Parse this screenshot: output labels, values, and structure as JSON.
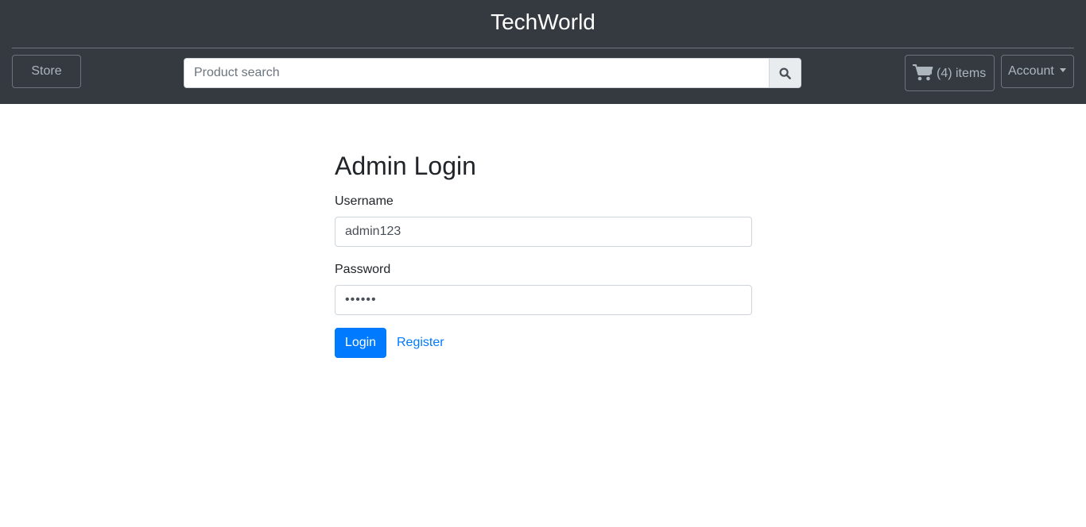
{
  "header": {
    "brand": "TechWorld",
    "store_label": "Store",
    "search": {
      "placeholder": "Product search"
    },
    "cart_label": "(4) items",
    "account_label": "Account"
  },
  "login": {
    "title": "Admin Login",
    "username_label": "Username",
    "username_value": "admin123",
    "password_label": "Password",
    "password_value": "123456",
    "login_button": "Login",
    "register_link": "Register"
  },
  "icons": {
    "search": "search-icon",
    "cart": "shopping-cart-icon",
    "account_caret": "caret-down-icon"
  },
  "colors": {
    "navbar_bg": "#343a40",
    "primary": "#007bff",
    "nav_text": "#adb5bd"
  }
}
